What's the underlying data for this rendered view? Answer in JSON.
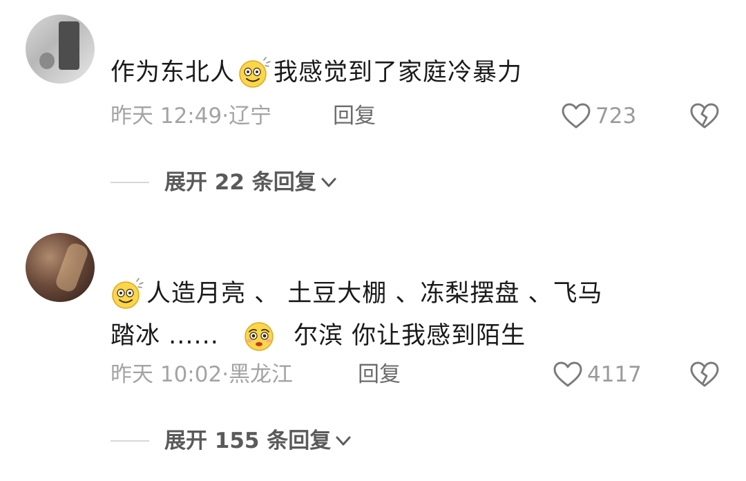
{
  "comments": [
    {
      "text_parts": [
        "作为东北人",
        "我感觉到了家庭冷暴力"
      ],
      "emoji_1": "smiling-sweat-emoji",
      "time": "昨天 12:49",
      "separator": "·",
      "location": "辽宁",
      "reply_label": "回复",
      "like_count": "723",
      "expand_label": "展开 22 条回复"
    },
    {
      "text_parts": [
        "人造月亮 、 土豆大棚 、冻梨摆盘 、飞马",
        "踏冰 ......",
        "尔滨 你让我感到陌生"
      ],
      "emoji_1": "smiling-sweat-emoji",
      "emoji_2": "pleading-emoji",
      "time": "昨天 10:02",
      "separator": "·",
      "location": "黑龙江",
      "reply_label": "回复",
      "like_count": "4117",
      "expand_label": "展开 155 条回复"
    }
  ],
  "colors": {
    "text": "#1a1a1a",
    "meta": "#a3a3a3",
    "reply": "#6b6b6b",
    "expand": "#5a5a5a",
    "icon": "#7a7a7a"
  }
}
